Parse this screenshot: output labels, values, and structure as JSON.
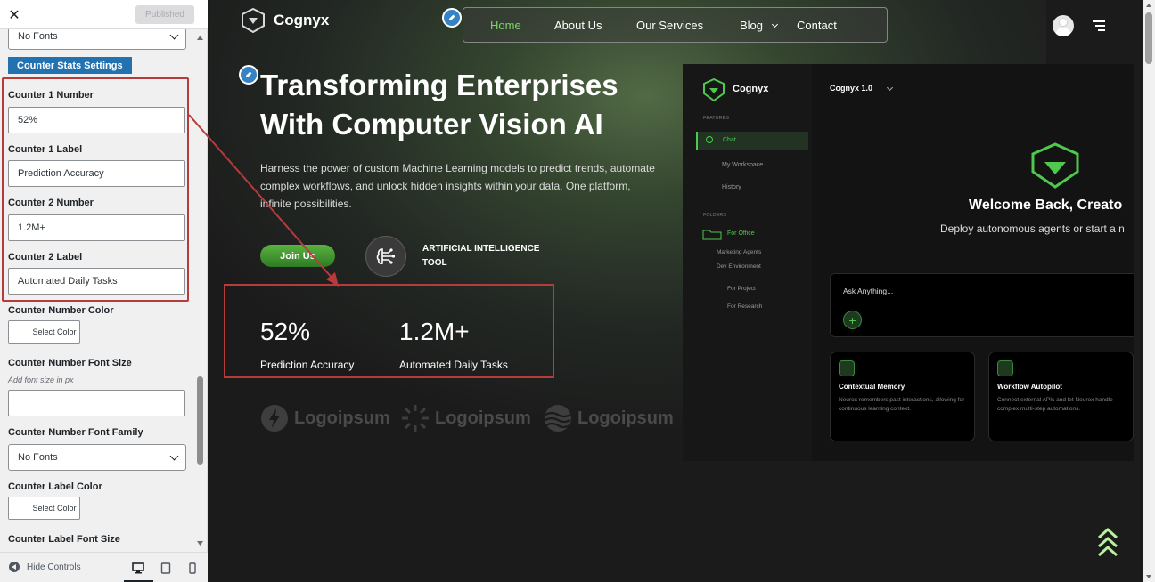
{
  "sidebar": {
    "close_label": "✕",
    "published_label": "Published",
    "top_select_value": "No Fonts",
    "section_title": "Counter Stats Settings",
    "fields": [
      {
        "label": "Counter 1 Number",
        "value": "52%"
      },
      {
        "label": "Counter 1 Label",
        "value": "Prediction Accuracy"
      },
      {
        "label": "Counter 2 Number",
        "value": "1.2M+"
      },
      {
        "label": "Counter 2 Label",
        "value": "Automated Daily Tasks"
      }
    ],
    "number_color_label": "Counter Number Color",
    "select_color_label": "Select Color",
    "number_font_size_label": "Counter Number Font Size",
    "font_size_hint": "Add font size in px",
    "number_font_size_value": "",
    "number_font_family_label": "Counter Number Font Family",
    "number_font_family_value": "No Fonts",
    "label_color_label": "Counter Label Color",
    "label_font_size_label": "Counter Label Font Size",
    "hide_controls_label": "Hide Controls"
  },
  "site": {
    "brand": "Cognyx",
    "nav": [
      "Home",
      "About Us",
      "Our Services",
      "Blog",
      "Contact"
    ],
    "hero_title_line1": "Transforming Enterprises",
    "hero_title_line2": "With Computer Vision AI",
    "hero_desc": "Harness the power of custom Machine Learning models to predict trends, automate complex workflows, and unlock hidden insights within your data. One platform, infinite possibilities.",
    "join_button": "Join Us",
    "ai_tool_line1": "ARTIFICIAL INTELLIGENCE",
    "ai_tool_line2": "TOOL",
    "stats": [
      {
        "number": "52%",
        "label": "Prediction Accuracy"
      },
      {
        "number": "1.2M+",
        "label": "Automated Daily Tasks"
      }
    ],
    "partner_logos": [
      "Logoipsum",
      "Logoipsum",
      "Logoipsum"
    ]
  },
  "dashboard": {
    "brand": "Cognyx",
    "version": "Cognyx 1.0",
    "features_heading": "FEATURES",
    "nav_chat": "Chat",
    "nav_workspace": "My Workspace",
    "nav_history": "History",
    "folders_heading": "FOLDERS",
    "folder_office": "For Office",
    "folder_items": [
      "Marketing Agents",
      "Dev Environment"
    ],
    "sub_items": [
      "For Project",
      "For Research"
    ],
    "welcome": "Welcome Back, Creato",
    "welcome_sub": "Deploy autonomous agents or start a n",
    "ask_placeholder": "Ask Anything...",
    "cards": [
      {
        "title": "Contextual Memory",
        "desc": "Neurox remembers past interactions, allowing for continuous learning context."
      },
      {
        "title": "Workflow Autopilot",
        "desc": "Connect external APIs and let Neurox handle complex multi-step automations."
      }
    ]
  },
  "colors": {
    "accent_green": "#4ec94e",
    "wp_blue": "#2271b1",
    "highlight_red": "#b83b3b"
  }
}
